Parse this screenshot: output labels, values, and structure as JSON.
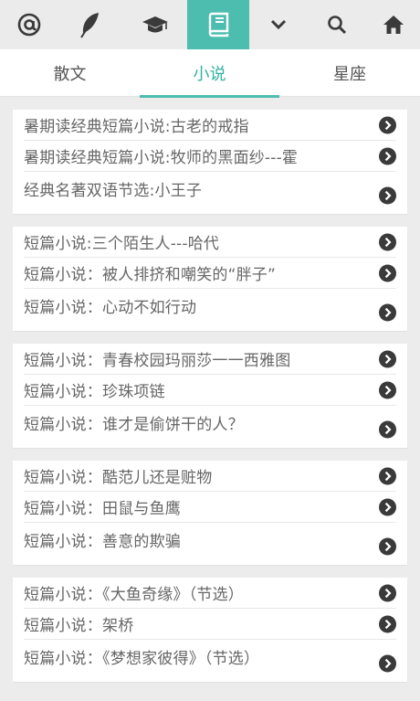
{
  "toolbar": {
    "items": [
      {
        "icon": "at-icon"
      },
      {
        "icon": "feather-icon"
      },
      {
        "icon": "graduation-cap-icon"
      },
      {
        "icon": "book-icon",
        "active": true
      },
      {
        "icon": "chevron-down-icon"
      },
      {
        "icon": "search-icon"
      },
      {
        "icon": "home-icon"
      }
    ],
    "accent_color": "#4dbdb0"
  },
  "tabs": [
    {
      "label": "散文"
    },
    {
      "label": "小说",
      "active": true
    },
    {
      "label": "星座"
    }
  ],
  "groups": [
    {
      "items": [
        "暑期读经典短篇小说:古老的戒指",
        "暑期读经典短篇小说:牧师的黑面纱---霍",
        "经典名著双语节选:小王子"
      ]
    },
    {
      "items": [
        "短篇小说:三个陌生人---哈代",
        "短篇小说：被人排挤和嘲笑的“胖子”",
        "短篇小说：心动不如行动"
      ]
    },
    {
      "items": [
        "短篇小说：青春校园玛丽莎一一西雅图",
        "短篇小说：珍珠项链",
        "短篇小说：谁才是偷饼干的人？"
      ]
    },
    {
      "items": [
        "短篇小说：酷范儿还是赃物",
        "短篇小说：田鼠与鱼鹰",
        "短篇小说：善意的欺骗"
      ]
    },
    {
      "items": [
        "短篇小说：《大鱼奇缘》（节选）",
        "短篇小说：架桥",
        "短篇小说：《梦想家彼得》（节选）"
      ]
    }
  ]
}
